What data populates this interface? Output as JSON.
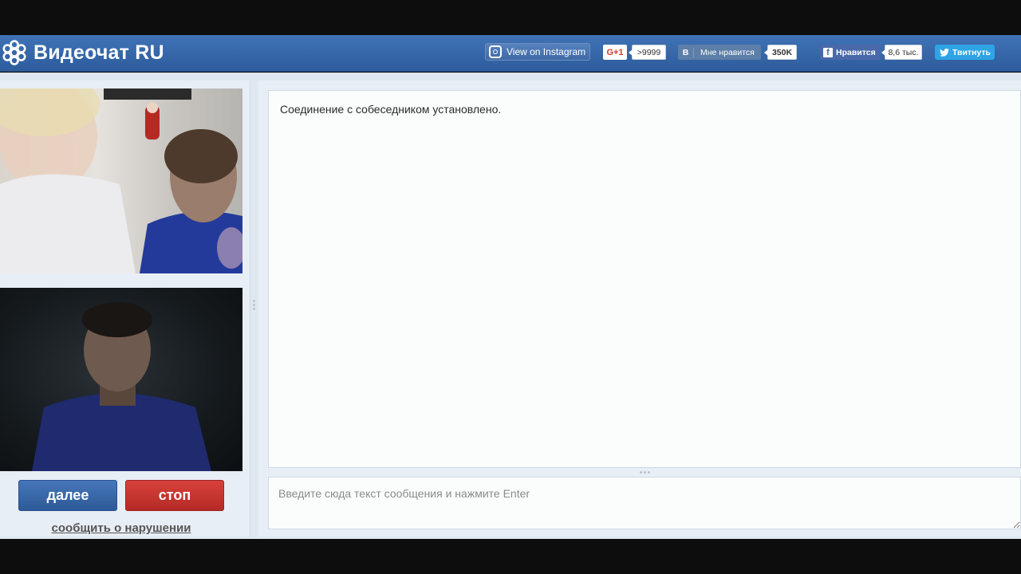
{
  "brand": {
    "name": "Видеочат RU"
  },
  "social": {
    "instagram_label": "View on Instagram",
    "gplus_label": "G+1",
    "gplus_count": ">9999",
    "vk_logo": "B",
    "vk_label": "Мне нравится",
    "vk_count": "350K",
    "fb_label": "Нравится",
    "fb_count": "8,6 тыс.",
    "tw_label": "Твитнуть"
  },
  "controls": {
    "next_label": "далее",
    "stop_label": "стоп",
    "report_label": "сообщить о нарушении"
  },
  "chat": {
    "messages": [
      "Соединение с собеседником установлено."
    ],
    "input_placeholder": "Введите сюда текст сообщения и нажмите Enter"
  },
  "colors": {
    "header": "#3a6aad",
    "next_button": "#3a69a8",
    "stop_button": "#c8352f"
  }
}
